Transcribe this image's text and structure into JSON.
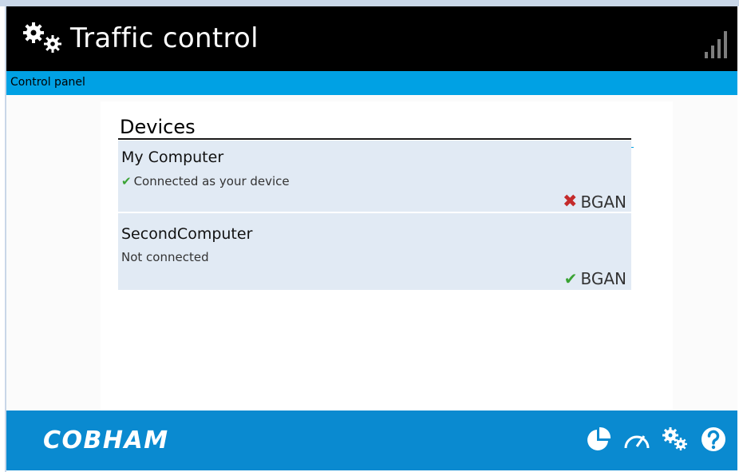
{
  "header": {
    "title": "Traffic control",
    "icon": "gears-icon",
    "signal_icon": "signal-strength-icon"
  },
  "subbar": {
    "label": "Control panel"
  },
  "devices": {
    "title": "Devices",
    "items": [
      {
        "name": "My Computer",
        "status": "Connected as your device",
        "status_icon": "check-icon",
        "network": "BGAN",
        "network_icon": "cross-icon"
      },
      {
        "name": "SecondComputer",
        "status": "Not connected",
        "status_icon": "",
        "network": "BGAN",
        "network_icon": "check-icon"
      }
    ]
  },
  "footer": {
    "brand": "COBHAM",
    "icons": [
      "pie-chart-icon",
      "speedometer-icon",
      "gears-icon",
      "help-icon"
    ]
  },
  "colors": {
    "accent": "#00a1e4",
    "footer": "#0a8ad0",
    "header": "#000000",
    "device_row": "#e1eaf4",
    "check": "#3aa334",
    "cross": "#c42b2b"
  }
}
